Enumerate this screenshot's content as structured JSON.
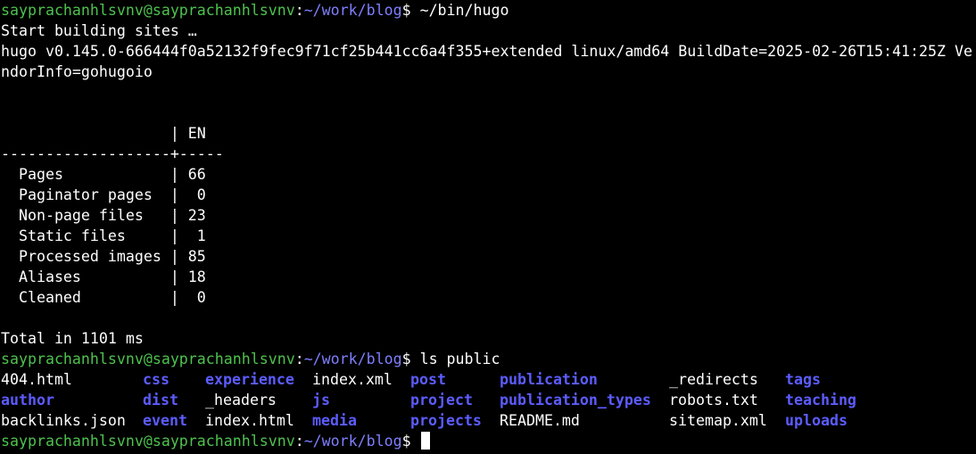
{
  "prompt": {
    "user_host": "sayprachanhlsvnv@sayprachanhlsvnv",
    "colon": ":",
    "cwd": "~/work/blog",
    "dollar": "$ "
  },
  "colors": {
    "user_host": "#4ec24e",
    "cwd": "#7f7fff",
    "directory": "#5c5cff",
    "text": "#ffffff",
    "background": "#000000"
  },
  "commands": {
    "first": "~/bin/hugo",
    "second": "ls public"
  },
  "output": {
    "start": "Start building sites …",
    "version": "hugo v0.145.0-666444f0a52132f9fec9f71cf25b441cc6a4f355+extended linux/amd64 BuildDate=2025-02-26T15:41:25Z VendorInfo=gohugoio",
    "table_header": "                   | EN",
    "table_separator": "-------------------+-----",
    "table_rows": [
      "  Pages            | 66",
      "  Paginator pages  |  0",
      "  Non-page files   | 23",
      "  Static files     |  1",
      "  Processed images | 85",
      "  Aliases          | 18",
      "  Cleaned          |  0"
    ],
    "total": "Total in 1101 ms"
  },
  "ls_listing": [
    [
      {
        "name": "404.html",
        "type": "file"
      },
      {
        "name": "css",
        "type": "dir"
      },
      {
        "name": "experience",
        "type": "dir"
      },
      {
        "name": "index.xml",
        "type": "file"
      },
      {
        "name": "post",
        "type": "dir"
      },
      {
        "name": "publication",
        "type": "dir"
      },
      {
        "name": "_redirects",
        "type": "file"
      },
      {
        "name": "tags",
        "type": "dir"
      }
    ],
    [
      {
        "name": "author",
        "type": "dir"
      },
      {
        "name": "dist",
        "type": "dir"
      },
      {
        "name": "_headers",
        "type": "file"
      },
      {
        "name": "js",
        "type": "dir"
      },
      {
        "name": "project",
        "type": "dir"
      },
      {
        "name": "publication_types",
        "type": "dir"
      },
      {
        "name": "robots.txt",
        "type": "file"
      },
      {
        "name": "teaching",
        "type": "dir"
      }
    ],
    [
      {
        "name": "backlinks.json",
        "type": "file"
      },
      {
        "name": "event",
        "type": "dir"
      },
      {
        "name": "index.html",
        "type": "file"
      },
      {
        "name": "media",
        "type": "dir"
      },
      {
        "name": "projects",
        "type": "dir"
      },
      {
        "name": "README.md",
        "type": "file"
      },
      {
        "name": "sitemap.xml",
        "type": "file"
      },
      {
        "name": "uploads",
        "type": "dir"
      }
    ]
  ]
}
